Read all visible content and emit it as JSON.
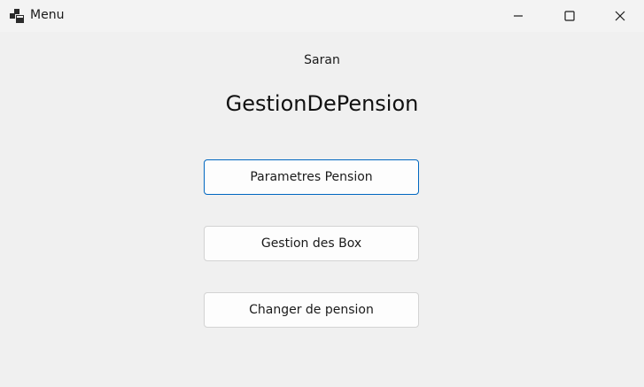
{
  "window": {
    "title": "Menu",
    "icon": "app-window-icon",
    "controls": {
      "minimize_icon": "minimize-icon",
      "maximize_icon": "maximize-icon",
      "close_icon": "close-icon"
    }
  },
  "content": {
    "user_name": "Saran",
    "app_title": "GestionDePension",
    "buttons": [
      {
        "label": "Parametres Pension",
        "focused": true
      },
      {
        "label": "Gestion des Box",
        "focused": false
      },
      {
        "label": "Changer de pension",
        "focused": false
      }
    ]
  },
  "colors": {
    "background": "#f0f0f0",
    "focus_accent": "#0067c0",
    "button_face": "#fdfdfd",
    "button_border": "#d3d3d3"
  }
}
